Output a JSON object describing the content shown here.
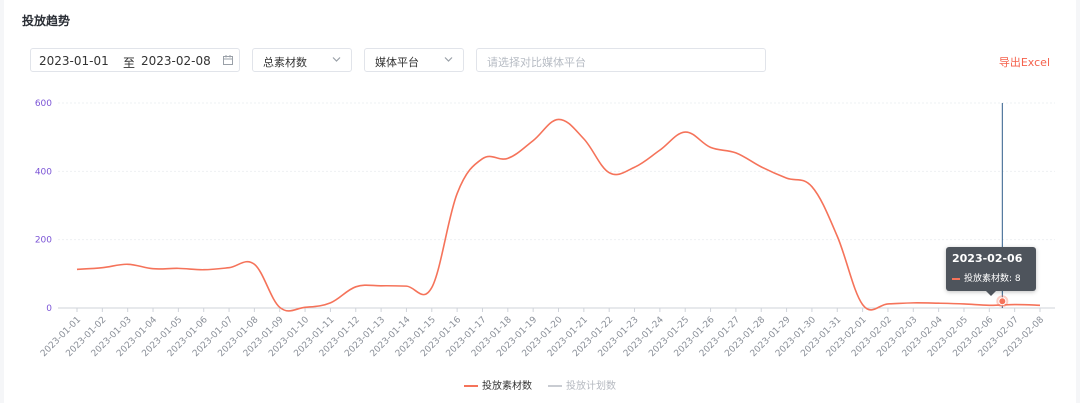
{
  "section": {
    "title": "投放趋势"
  },
  "filters": {
    "start_date": "2023-01-01",
    "separator": "至",
    "end_date": "2023-02-08",
    "metric_select": "总素材数",
    "platform_select": "媒体平台",
    "compare_placeholder": "请选择对比媒体平台"
  },
  "actions": {
    "export_label": "导出Excel"
  },
  "colors": {
    "series_primary": "#f5735a",
    "series_secondary": "#c9ccd2",
    "crosshair": "#2f5d8a",
    "axis_tick": "#7b54d6"
  },
  "tooltip": {
    "date": "2023-02-06",
    "series_label": "投放素材数:",
    "value": "8"
  },
  "chart_data": {
    "type": "line",
    "categories": [
      "2023-01-01",
      "2023-01-02",
      "2023-01-03",
      "2023-01-04",
      "2023-01-05",
      "2023-01-06",
      "2023-01-07",
      "2023-01-08",
      "2023-01-09",
      "2023-01-10",
      "2023-01-11",
      "2023-01-12",
      "2023-01-13",
      "2023-01-14",
      "2023-01-15",
      "2023-01-16",
      "2023-01-17",
      "2023-01-18",
      "2023-01-19",
      "2023-01-20",
      "2023-01-21",
      "2023-01-22",
      "2023-01-23",
      "2023-01-24",
      "2023-01-25",
      "2023-01-26",
      "2023-01-27",
      "2023-01-28",
      "2023-01-29",
      "2023-01-30",
      "2023-01-31",
      "2023-02-01",
      "2023-02-02",
      "2023-02-03",
      "2023-02-04",
      "2023-02-05",
      "2023-02-06",
      "2023-02-07",
      "2023-02-08"
    ],
    "series": [
      {
        "name": "投放素材数",
        "values": [
          113,
          118,
          128,
          115,
          116,
          112,
          118,
          128,
          2,
          2,
          15,
          62,
          65,
          64,
          60,
          335,
          437,
          438,
          490,
          552,
          495,
          396,
          412,
          462,
          515,
          470,
          454,
          413,
          380,
          355,
          210,
          10,
          12,
          15,
          14,
          12,
          8,
          10,
          8
        ]
      },
      {
        "name": "投放计划数",
        "values": []
      }
    ],
    "yticks": [
      0,
      200,
      400,
      600
    ],
    "ylim": [
      0,
      600
    ],
    "grid": true,
    "legend_position": "bottom-center",
    "highlight_index": 36
  }
}
